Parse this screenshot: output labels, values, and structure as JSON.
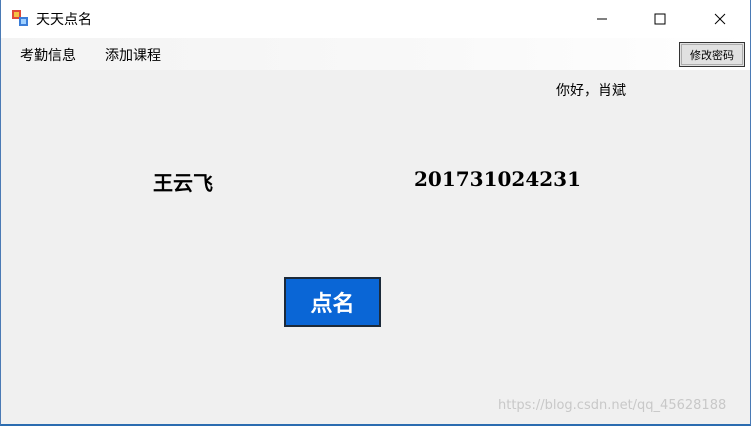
{
  "window": {
    "title": "天天点名",
    "icon": "app-form-icon"
  },
  "menu": {
    "items": [
      {
        "label": "考勤信息"
      },
      {
        "label": "添加课程"
      }
    ]
  },
  "toolbar": {
    "change_password_label": "修改密码"
  },
  "greeting": "你好，肖斌",
  "student": {
    "name": "王云飞",
    "id": "201731024231"
  },
  "actions": {
    "roll_call_label": "点名"
  },
  "watermark": "https://blog.csdn.net/qq_45628188",
  "colors": {
    "button_blue": "#0a66d6",
    "background": "#f0f0f0"
  }
}
